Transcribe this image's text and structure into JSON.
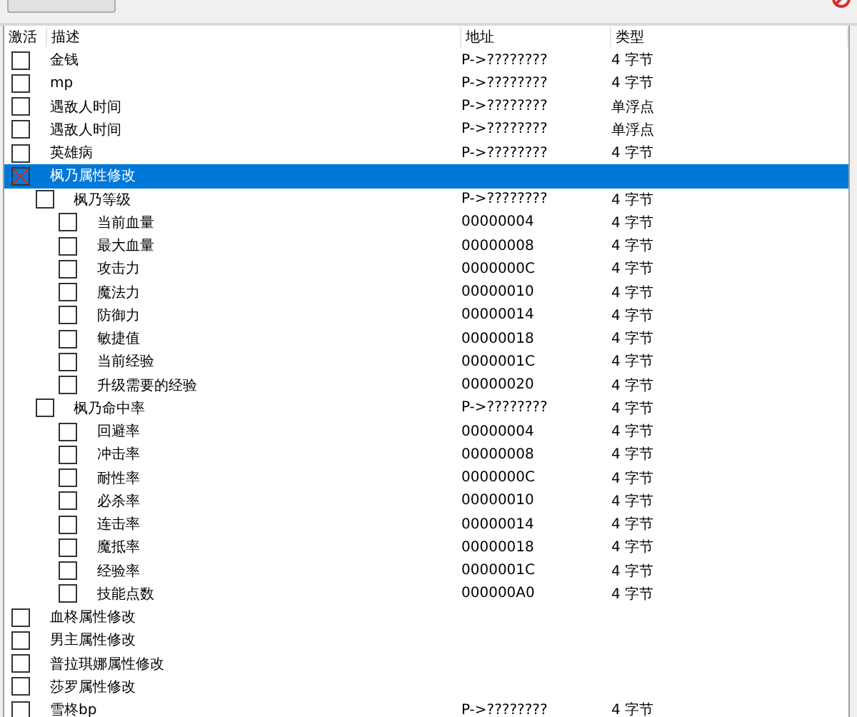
{
  "columns": [
    "激活",
    "描述",
    "地址",
    "类型"
  ],
  "entries": [
    {
      "description": "金钱",
      "address": "P->????????",
      "type": "4 字节",
      "selected": false
    },
    {
      "description": "mp",
      "address": "P->????????",
      "type": "4 字节",
      "selected": false
    },
    {
      "description": "遇敌人时间",
      "address": "P->????????",
      "type": "单浮点",
      "selected": false
    },
    {
      "description": "遇敌人时间",
      "address": "P->????????",
      "type": "单浮点",
      "selected": false
    },
    {
      "description": "英雄病",
      "address": "P->????????",
      "type": "4 字节",
      "selected": false
    },
    {
      "description": "枫乃属性修改",
      "selected": true,
      "children": [
        {
          "description": "枫乃等级",
          "address": "P->????????",
          "type": "4 字节",
          "selected": false,
          "children": [
            {
              "description": "当前血量",
              "address": "00000004",
              "type": "4 字节",
              "selected": false
            },
            {
              "description": "最大血量",
              "address": "00000008",
              "type": "4 字节",
              "selected": false
            },
            {
              "description": "攻击力",
              "address": "0000000C",
              "type": "4 字节",
              "selected": false
            },
            {
              "description": "魔法力",
              "address": "00000010",
              "type": "4 字节",
              "selected": false
            },
            {
              "description": "防御力",
              "address": "00000014",
              "type": "4 字节",
              "selected": false
            },
            {
              "description": "敏捷值",
              "address": "00000018",
              "type": "4 字节",
              "selected": false
            },
            {
              "description": "当前经验",
              "address": "0000001C",
              "type": "4 字节",
              "selected": false
            },
            {
              "description": "升级需要的经验",
              "address": "00000020",
              "type": "4 字节",
              "selected": false
            }
          ]
        },
        {
          "description": "枫乃命中率",
          "address": "P->????????",
          "type": "4 字节",
          "selected": false,
          "children": [
            {
              "description": "回避率",
              "address": "00000004",
              "type": "4 字节",
              "selected": false
            },
            {
              "description": "冲击率",
              "address": "00000008",
              "type": "4 字节",
              "selected": false
            },
            {
              "description": "耐性率",
              "address": "0000000C",
              "type": "4 字节",
              "selected": false
            },
            {
              "description": "必杀率",
              "address": "00000010",
              "type": "4 字节",
              "selected": false
            },
            {
              "description": "连击率",
              "address": "00000014",
              "type": "4 字节",
              "selected": false
            },
            {
              "description": "魔抵率",
              "address": "00000018",
              "type": "4 字节",
              "selected": false
            },
            {
              "description": "经验率",
              "address": "0000001C",
              "type": "4 字节",
              "selected": false
            },
            {
              "description": "技能点数",
              "address": "000000A0",
              "type": "4 字节",
              "selected": false
            }
          ]
        }
      ]
    },
    {
      "description": "血柊属性修改",
      "selected": false
    },
    {
      "description": "男主属性修改",
      "selected": false
    },
    {
      "description": "普拉琪娜属性修改",
      "selected": false
    },
    {
      "description": "莎罗属性修改",
      "selected": false
    },
    {
      "description": "雪柊bp",
      "address": "P->????????",
      "type": "4 字节",
      "selected": false
    }
  ]
}
